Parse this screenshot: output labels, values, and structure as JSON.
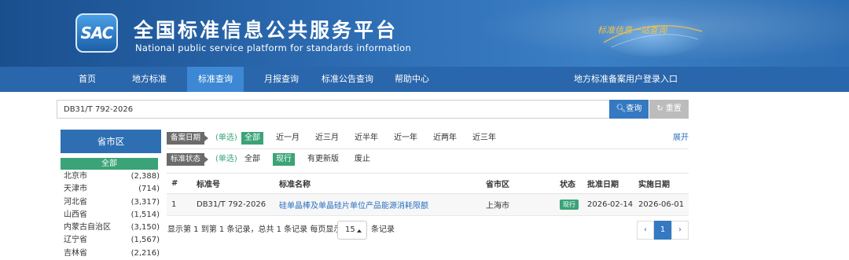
{
  "header": {
    "logo_text": "SAC",
    "title": "全国标准信息公共服务平台",
    "subtitle": "National public service platform  for standards information",
    "slogan": "标准信息一站查询"
  },
  "nav": {
    "items": [
      {
        "label": "首页"
      },
      {
        "label": "地方标准"
      },
      {
        "label": "标准查询"
      },
      {
        "label": "月报查询"
      },
      {
        "label": "标准公告查询"
      },
      {
        "label": "帮助中心"
      }
    ],
    "right_link": "地方标准备案用户登录入口"
  },
  "search": {
    "value": "DB31/T 792-2026",
    "search_button": "查询",
    "reset_button": "重置"
  },
  "region": {
    "title": "省市区",
    "all_label": "全部",
    "items": [
      {
        "name": "北京市",
        "count": "(2,388)"
      },
      {
        "name": "天津市",
        "count": "(714)"
      },
      {
        "name": "河北省",
        "count": "(3,317)"
      },
      {
        "name": "山西省",
        "count": "(1,514)"
      },
      {
        "name": "内蒙古自治区",
        "count": "(3,150)"
      },
      {
        "name": "辽宁省",
        "count": "(1,567)"
      },
      {
        "name": "吉林省",
        "count": "(2,216)"
      }
    ]
  },
  "filters": {
    "date": {
      "label": "备案日期",
      "hint": "(单选)",
      "options": [
        "全部",
        "近一月",
        "近三月",
        "近半年",
        "近一年",
        "近两年",
        "近三年"
      ],
      "selected": "全部"
    },
    "status": {
      "label": "标准状态",
      "hint": "(单选)",
      "options": [
        "全部",
        "现行",
        "有更新版",
        "废止"
      ],
      "selected": "现行"
    },
    "expand": "展开"
  },
  "table": {
    "headers": [
      "#",
      "标准号",
      "标准名称",
      "省市区",
      "状态",
      "批准日期",
      "实施日期"
    ],
    "rows": [
      {
        "index": "1",
        "code": "DB31/T 792-2026",
        "name": "硅单晶棒及单晶硅片单位产品能源消耗限额",
        "region": "上海市",
        "status": "现行",
        "approved": "2026-02-14",
        "effective": "2026-06-01"
      }
    ]
  },
  "pagination": {
    "info": "显示第 1 到第 1 条记录，总共 1 条记录 每页显示",
    "page_size": "15",
    "suffix": "条记录",
    "prev": "‹",
    "current": "1",
    "next": "›"
  },
  "colors": {
    "primary": "#2a66ab",
    "nav_active": "#3d88d4",
    "green": "#3aa377",
    "link": "#2a70c0"
  }
}
